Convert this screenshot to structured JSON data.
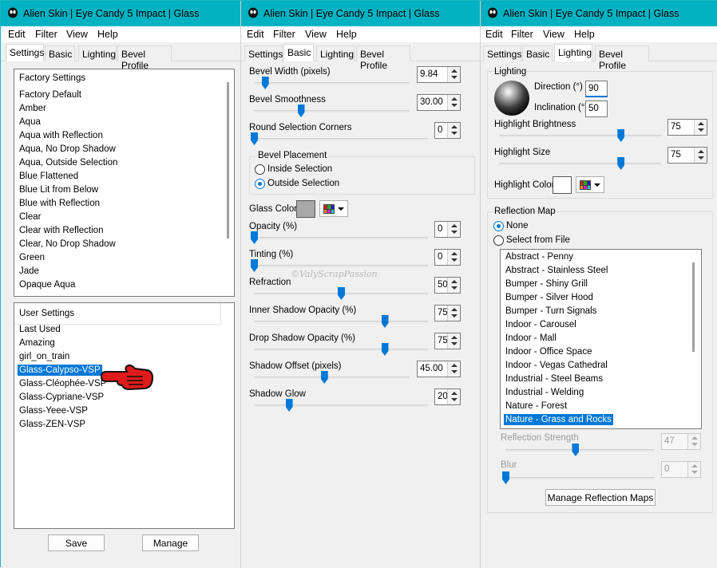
{
  "window_title": "Alien Skin | Eye Candy 5 Impact | Glass",
  "menu": [
    "Edit",
    "Filter",
    "View",
    "Help"
  ],
  "tabs": [
    "Settings",
    "Basic",
    "Lighting",
    "Bevel Profile"
  ],
  "settings": {
    "factory_header": "Factory Settings",
    "factory_items": [
      "Factory Default",
      "Amber",
      "Aqua",
      "Aqua with Reflection",
      "Aqua, No Drop Shadow",
      "Aqua, Outside Selection",
      "Blue Flattened",
      "Blue Lit from Below",
      "Blue with Reflection",
      "Clear",
      "Clear with Reflection",
      "Clear, No Drop Shadow",
      "Green",
      "Jade",
      "Opaque Aqua"
    ],
    "user_header": "User Settings",
    "user_items": [
      "Last Used",
      "Amazing",
      "girl_on_train",
      "Glass-Calypso-VSP",
      "Glass-Cléophée-VSP",
      "Glass-Cypriane-VSP",
      "Glass-Yeee-VSP",
      "Glass-ZEN-VSP"
    ],
    "selected_user_item": "Glass-Calypso-VSP",
    "save_label": "Save",
    "manage_label": "Manage"
  },
  "basic": {
    "bevel_width_label": "Bevel Width (pixels)",
    "bevel_width": "9.84",
    "bevel_width_level": 0.07,
    "bevel_smooth_label": "Bevel Smoothness",
    "bevel_smooth": "30.00",
    "bevel_smooth_level": 0.3,
    "round_corners_label": "Round Selection Corners",
    "round_corners": "0",
    "round_corners_level": 0,
    "placement_label": "Bevel Placement",
    "inside_label": "Inside Selection",
    "outside_label": "Outside Selection",
    "placement_selected": "Outside Selection",
    "glass_color_label": "Glass Color",
    "glass_color": "#a8a8a8",
    "opacity_label": "Opacity (%)",
    "opacity": "0",
    "opacity_level": 0,
    "tinting_label": "Tinting (%)",
    "tinting": "0",
    "tinting_level": 0,
    "refraction_label": "Refraction",
    "refraction": "50",
    "refraction_level": 0.5,
    "inner_shadow_label": "Inner Shadow Opacity (%)",
    "inner_shadow": "75",
    "inner_shadow_level": 0.75,
    "drop_shadow_label": "Drop Shadow Opacity (%)",
    "drop_shadow": "75",
    "drop_shadow_level": 0.75,
    "shadow_offset_label": "Shadow Offset (pixels)",
    "shadow_offset": "45.00",
    "shadow_offset_level": 0.45,
    "shadow_glow_label": "Shadow Glow",
    "shadow_glow": "20",
    "shadow_glow_level": 0.2,
    "watermark": "©ValyScrapPassion"
  },
  "lighting": {
    "group_label": "Lighting",
    "direction_label": "Direction (°)",
    "direction": "90",
    "inclination_label": "Inclination (°)",
    "inclination": "50",
    "highlight_brightness_label": "Highlight Brightness",
    "highlight_brightness": "75",
    "highlight_brightness_level": 0.75,
    "highlight_size_label": "Highlight Size",
    "highlight_size": "75",
    "highlight_size_level": 0.75,
    "highlight_color_label": "Highlight Color",
    "highlight_color": "#ffffff",
    "reflection_group_label": "Reflection Map",
    "none_label": "None",
    "from_file_label": "Select from File",
    "reflection_selected": "None",
    "maps": [
      "Abstract - Penny",
      "Abstract - Stainless Steel",
      "Bumper - Shiny Grill",
      "Bumper - Silver Hood",
      "Bumper - Turn Signals",
      "Indoor - Carousel",
      "Indoor - Mall",
      "Indoor - Office Space",
      "Indoor - Vegas Cathedral",
      "Industrial - Steel Beams",
      "Industrial - Welding",
      "Nature - Forest",
      "Nature - Grass and Rocks"
    ],
    "selected_map": "Nature - Grass and Rocks",
    "reflection_strength_label": "Reflection Strength",
    "reflection_strength": "47",
    "reflection_strength_level": 0.47,
    "blur_label": "Blur",
    "blur": "0",
    "blur_level": 0,
    "manage_maps_label": "Manage Reflection Maps"
  },
  "colors": {
    "titlebar": "#00b2c2",
    "accent": "#0078d7",
    "pointer": "#e01b1b"
  }
}
